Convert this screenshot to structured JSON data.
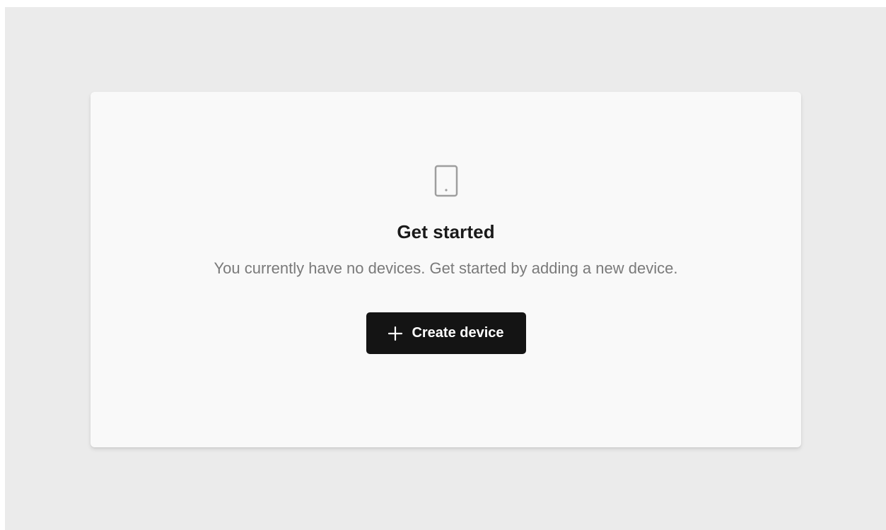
{
  "empty_state": {
    "icon": "device-tablet-icon",
    "title": "Get started",
    "description": "You currently have no devices. Get started by adding a new device.",
    "button": {
      "icon": "plus-icon",
      "label": "Create device"
    }
  },
  "colors": {
    "page_background": "#ebebeb",
    "card_background": "#f9f9f9",
    "button_background": "#141414",
    "button_text": "#ffffff",
    "title_text": "#1a1a1a",
    "description_text": "#7a7a7a",
    "icon_stroke": "#9e9e9e"
  }
}
